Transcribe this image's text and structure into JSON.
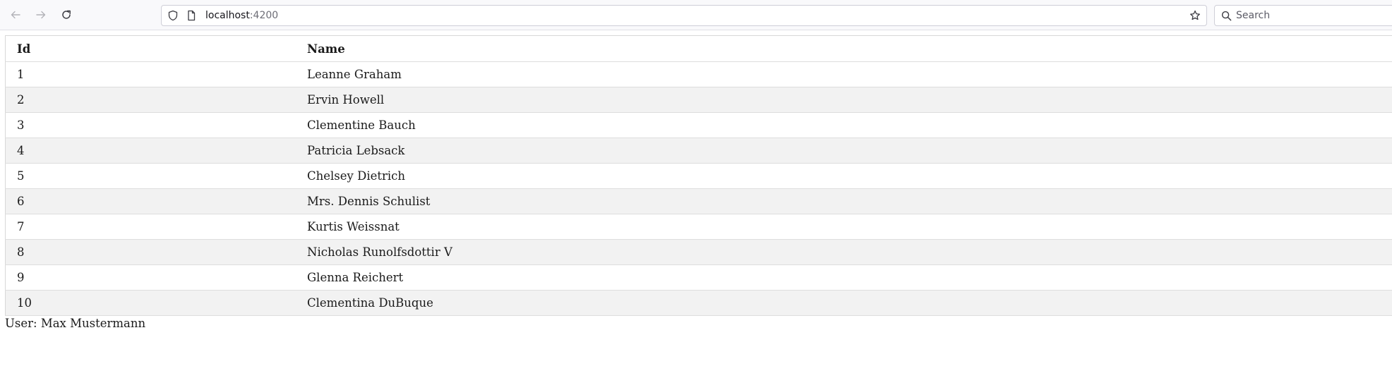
{
  "browser": {
    "url_host": "localhost",
    "url_port": ":4200",
    "search_placeholder": "Search"
  },
  "table": {
    "headers": {
      "id": "Id",
      "name": "Name"
    },
    "rows": [
      {
        "id": "1",
        "name": "Leanne Graham"
      },
      {
        "id": "2",
        "name": "Ervin Howell"
      },
      {
        "id": "3",
        "name": "Clementine Bauch"
      },
      {
        "id": "4",
        "name": "Patricia Lebsack"
      },
      {
        "id": "5",
        "name": "Chelsey Dietrich"
      },
      {
        "id": "6",
        "name": "Mrs. Dennis Schulist"
      },
      {
        "id": "7",
        "name": "Kurtis Weissnat"
      },
      {
        "id": "8",
        "name": "Nicholas Runolfsdottir V"
      },
      {
        "id": "9",
        "name": "Glenna Reichert"
      },
      {
        "id": "10",
        "name": "Clementina DuBuque"
      }
    ]
  },
  "footer": {
    "user_text": "User: Max Mustermann"
  }
}
